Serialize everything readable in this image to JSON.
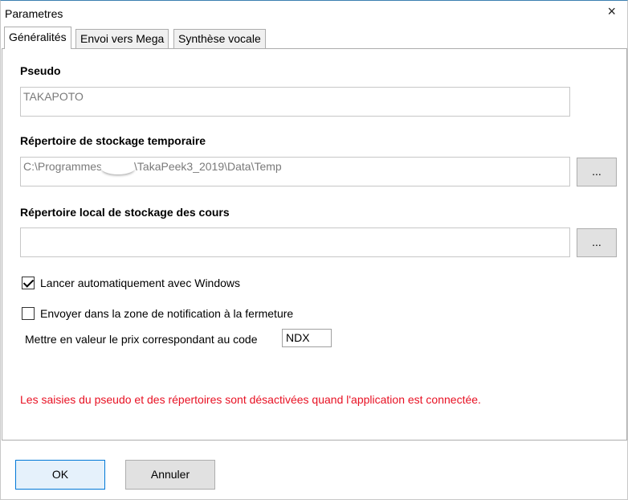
{
  "window": {
    "title": "Parametres",
    "close_label": "×"
  },
  "tabs": [
    {
      "label": "Généralités",
      "active": true
    },
    {
      "label": "Envoi vers Mega",
      "active": false
    },
    {
      "label": "Synthèse vocale",
      "active": false
    }
  ],
  "pseudo": {
    "label": "Pseudo",
    "value": "TAKAPOTO"
  },
  "temp_dir": {
    "label": "Répertoire de stockage temporaire",
    "value_start": "C:\\Programmes",
    "value_end": "\\TakaPeek3_2019\\Data\\Temp",
    "browse_label": "..."
  },
  "local_dir": {
    "label": "Répertoire local de stockage des cours",
    "value": "",
    "browse_label": "..."
  },
  "options": {
    "autostart": {
      "label": "Lancer automatiquement avec Windows",
      "checked": true
    },
    "tray": {
      "label": "Envoyer dans la zone de notification à la fermeture",
      "checked": false
    },
    "highlight_label": "Mettre en valeur le prix correspondant au code",
    "highlight_code": "NDX"
  },
  "warning": "Les saisies du pseudo et des répertoires sont désactivées quand l'application est connectée.",
  "buttons": {
    "ok": "OK",
    "cancel": "Annuler"
  }
}
